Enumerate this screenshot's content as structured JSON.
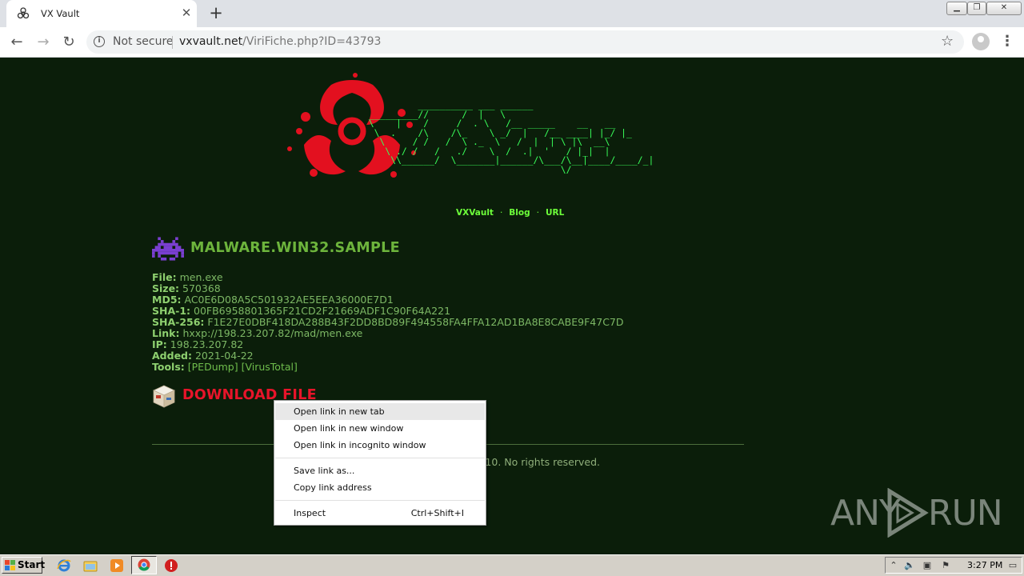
{
  "browser": {
    "tab_title": "VX Vault",
    "tab_close": "✕",
    "new_tab": "+",
    "security_label": "Not secure",
    "url_host": "vxvault.net",
    "url_path": "/ViriFiche.php?ID=43793",
    "window_controls": [
      "minimize-icon",
      "restore-icon",
      "close-icon"
    ]
  },
  "page": {
    "ascii_logo": "           __________ ___ ______\n  _________//      /  |   \\\n  \\    |    /     /  . \\   /__ _____    __   __\n   \\  .    /\\    /\\_    \\ _/  |   /__ ____| |_/ |_\n    \\     / /   /  \\ ._  \\   /  |  | \\ |\\  __\\\n     \\ ./ /   /   ./    \\  /  .|  '   / |_|  |\n      \\\\______/  \\_______|______/\\___/\\__|____/____/_|\n                                     \\/",
    "nav": [
      "VXVault",
      "Blog",
      "URL"
    ],
    "nav_sep": "·",
    "sample_title": "MALWARE.WIN32.SAMPLE",
    "fields": [
      {
        "key": "File:",
        "value": "men.exe"
      },
      {
        "key": "Size:",
        "value": "570368"
      },
      {
        "key": "MD5:",
        "value": "AC0E6D08A5C501932AE5EEA36000E7D1"
      },
      {
        "key": "SHA-1:",
        "value": "00FB6958801365F21CD2F21669ADF1C90F64A221"
      },
      {
        "key": "SHA-256:",
        "value": "F1E27E0DBF418DA288B43F2DD8BD89F494558FA4FFA12AD1BA8E8CABE9F47C7D"
      },
      {
        "key": "Link:",
        "value": "hxxp://198.23.207.82/mad/men.exe"
      },
      {
        "key": "IP:",
        "value": "198.23.207.82"
      },
      {
        "key": "Added:",
        "value": "2021-04-22"
      }
    ],
    "tools_label": "Tools:",
    "tools": [
      "[PEDump]",
      "[VirusTotal]"
    ],
    "download_label": "DOWNLOAD FILE",
    "footer": "10. No rights reserved.",
    "watermark": [
      "ANY",
      "RUN"
    ]
  },
  "context_menu": {
    "items": [
      {
        "label": "Open link in new tab",
        "shortcut": ""
      },
      {
        "label": "Open link in new window",
        "shortcut": ""
      },
      {
        "label": "Open link in incognito window",
        "shortcut": ""
      },
      {
        "label": "Save link as...",
        "shortcut": ""
      },
      {
        "label": "Copy link address",
        "shortcut": ""
      },
      {
        "label": "Inspect",
        "shortcut": "Ctrl+Shift+I"
      }
    ]
  },
  "taskbar": {
    "start_label": "Start",
    "apps": [
      "ie-icon",
      "explorer-icon",
      "media-player-icon",
      "chrome-icon",
      "stop-icon"
    ],
    "clock": "3:27 PM"
  },
  "colors": {
    "page_bg": "#0b1e0a",
    "ascii_green": "#39ff5a",
    "title_green": "#6db43c",
    "download_red": "#e8142a"
  }
}
